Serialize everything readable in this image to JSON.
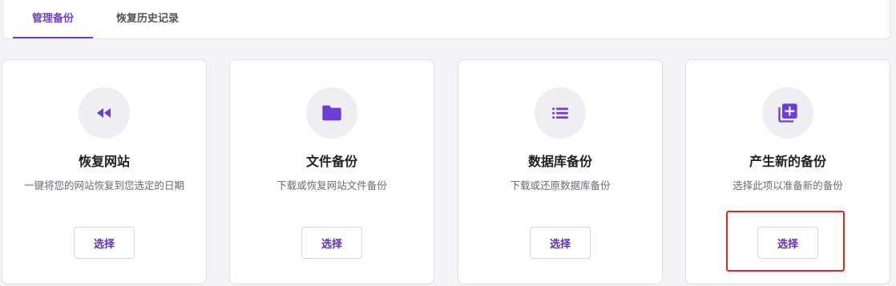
{
  "tabs": [
    {
      "label": "管理备份",
      "active": true
    },
    {
      "label": "恢复历史记录",
      "active": false
    }
  ],
  "accent_color": "#6b3fd4",
  "highlight_color": "#e0281f",
  "cards": [
    {
      "icon": "rewind-icon",
      "title": "恢复网站",
      "description": "一键将您的网站恢复到您选定的日期",
      "button": "选择"
    },
    {
      "icon": "folder-icon",
      "title": "文件备份",
      "description": "下载或恢复网站文件备份",
      "button": "选择"
    },
    {
      "icon": "list-icon",
      "title": "数据库备份",
      "description": "下载或还原数据库备份",
      "button": "选择"
    },
    {
      "icon": "add-library-icon",
      "title": "产生新的备份",
      "description": "选择此项以准备新的备份",
      "button": "选择"
    }
  ]
}
